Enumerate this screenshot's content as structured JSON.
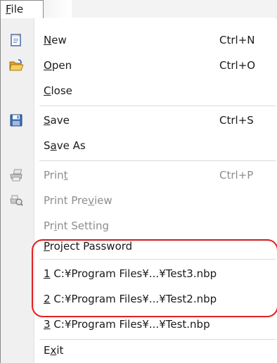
{
  "menubar": {
    "file_menu": {
      "mnemonic": "F",
      "rest": "ile"
    }
  },
  "menu": {
    "new": {
      "mnemonic": "N",
      "rest": "ew",
      "shortcut": "Ctrl+N",
      "icon": "new-document-icon"
    },
    "open": {
      "mnemonic": "O",
      "rest": "pen",
      "shortcut": "Ctrl+O",
      "icon": "open-folder-icon"
    },
    "close": {
      "mnemonic": "C",
      "rest": "lose"
    },
    "save": {
      "mnemonic": "S",
      "rest": "ave",
      "shortcut": "Ctrl+S",
      "icon": "floppy-disk-icon"
    },
    "save_as": {
      "pre": "S",
      "mnemonic": "a",
      "rest": "ve As"
    },
    "print": {
      "pre": "Prin",
      "mnemonic": "t",
      "rest": "",
      "shortcut": "Ctrl+P",
      "icon": "printer-icon",
      "disabled": true
    },
    "print_preview": {
      "pre": "Print Pre",
      "mnemonic": "v",
      "rest": "iew",
      "icon": "print-preview-icon",
      "disabled": true
    },
    "print_setting": {
      "pre": "Pr",
      "mnemonic": "i",
      "rest": "nt Setting",
      "disabled": true
    },
    "project_password": {
      "mnemonic": "P",
      "rest": "roject Password"
    },
    "recent_files": [
      {
        "mnemonic": "1",
        "rest": " C:¥Program Files¥...¥Test3.nbp"
      },
      {
        "mnemonic": "2",
        "rest": " C:¥Program Files¥...¥Test2.nbp"
      },
      {
        "mnemonic": "3",
        "rest": " C:¥Program Files¥...¥Test.nbp"
      }
    ],
    "exit": {
      "pre": "E",
      "mnemonic": "x",
      "rest": "it"
    }
  },
  "colors": {
    "highlight_frame": "#e32020",
    "disabled_text": "#8d8d8d",
    "gutter": "#f0f0f0"
  }
}
